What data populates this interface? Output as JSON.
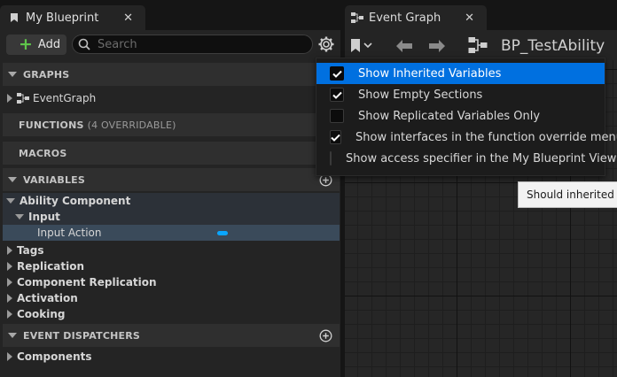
{
  "my_blueprint": {
    "tab_title": "My Blueprint",
    "close_glyph": "✕",
    "add_label": "Add",
    "search_placeholder": "Search",
    "icons": [
      "blueprint-tab-icon",
      "plus-icon",
      "search-icon",
      "gear-icon",
      "add-circle-icon"
    ],
    "sections": {
      "graphs": "GRAPHS",
      "functions": "FUNCTIONS",
      "functions_note": "(4 OVERRIDABLE)",
      "macros": "MACROS",
      "variables": "VARIABLES",
      "event_dispatchers": "EVENT DISPATCHERS"
    },
    "graph_items": [
      "EventGraph"
    ],
    "variables": {
      "ability_component": "Ability Component",
      "input": "Input",
      "input_action": "Input Action",
      "tags": "Tags",
      "replication": "Replication",
      "component_replication": "Component Replication",
      "activation": "Activation",
      "cooking": "Cooking"
    },
    "dispatchers": [
      "Components"
    ]
  },
  "event_graph": {
    "tab_title": "Event Graph",
    "close_glyph": "✕",
    "blueprint_name": "BP_TestAbility",
    "icons": [
      "bookmark-icon",
      "back-arrow-icon",
      "forward-arrow-icon",
      "graph-nodes-icon"
    ]
  },
  "settings_menu": {
    "items": [
      {
        "label": "Show Inherited Variables",
        "checked": true,
        "highlighted": true
      },
      {
        "label": "Show Empty Sections",
        "checked": true,
        "highlighted": false
      },
      {
        "label": "Show Replicated Variables Only",
        "checked": false,
        "highlighted": false
      },
      {
        "label": "Show interfaces in the function override menu",
        "checked": true,
        "highlighted": false
      },
      {
        "label": "Show access specifier in the My Blueprint View",
        "checked": false,
        "highlighted": false
      }
    ]
  },
  "tooltip": {
    "text": "Should inherited va"
  },
  "colors": {
    "accent": "#0070e0",
    "add_green": "#5ec54a",
    "variable_pill": "#0aa6ff",
    "selected_row": "#3a4a5a"
  }
}
